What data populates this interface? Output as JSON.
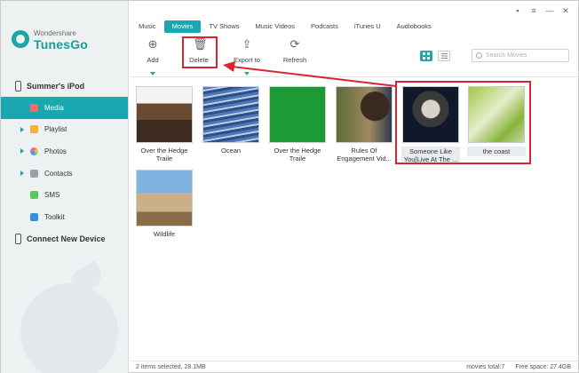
{
  "app": {
    "brand_top": "Wondershare",
    "brand_name": "TunesGo"
  },
  "sidebar": {
    "device_name": "Summer's iPod",
    "items": [
      {
        "label": "Media",
        "active": true,
        "icon": "media-icon"
      },
      {
        "label": "Playlist",
        "icon": "playlist-icon"
      },
      {
        "label": "Photos",
        "icon": "photos-icon"
      },
      {
        "label": "Contacts",
        "icon": "contacts-icon"
      },
      {
        "label": "SMS",
        "icon": "sms-icon"
      },
      {
        "label": "Toolkit",
        "icon": "toolkit-icon"
      }
    ],
    "connect_label": "Connect New Device"
  },
  "tabs": [
    {
      "label": "Music"
    },
    {
      "label": "Movies",
      "active": true
    },
    {
      "label": "TV Shows"
    },
    {
      "label": "Music Videos"
    },
    {
      "label": "Podcasts"
    },
    {
      "label": "iTunes U"
    },
    {
      "label": "Audiobooks"
    }
  ],
  "toolbar": {
    "add_label": "Add",
    "delete_label": "Delete",
    "export_label": "Export to",
    "refresh_label": "Refresh",
    "search_placeholder": "Search Movies"
  },
  "movies": [
    {
      "title": "Over the Hedge Traile"
    },
    {
      "title": "Ocean"
    },
    {
      "title": "Over the Hedge Traile"
    },
    {
      "title": "Rules Of Engagement Vid..."
    },
    {
      "title": "Someone Like You[Live At The ...",
      "selected": true
    },
    {
      "title": "the coast",
      "selected": true
    },
    {
      "title": "Wildlife"
    }
  ],
  "status": {
    "selection": "2 items selected, 28.1MB",
    "total": "movies total:7",
    "free": "Free space: 27.4GB"
  },
  "colors": {
    "accent": "#1aa7b0",
    "annotation": "#d9252f"
  }
}
